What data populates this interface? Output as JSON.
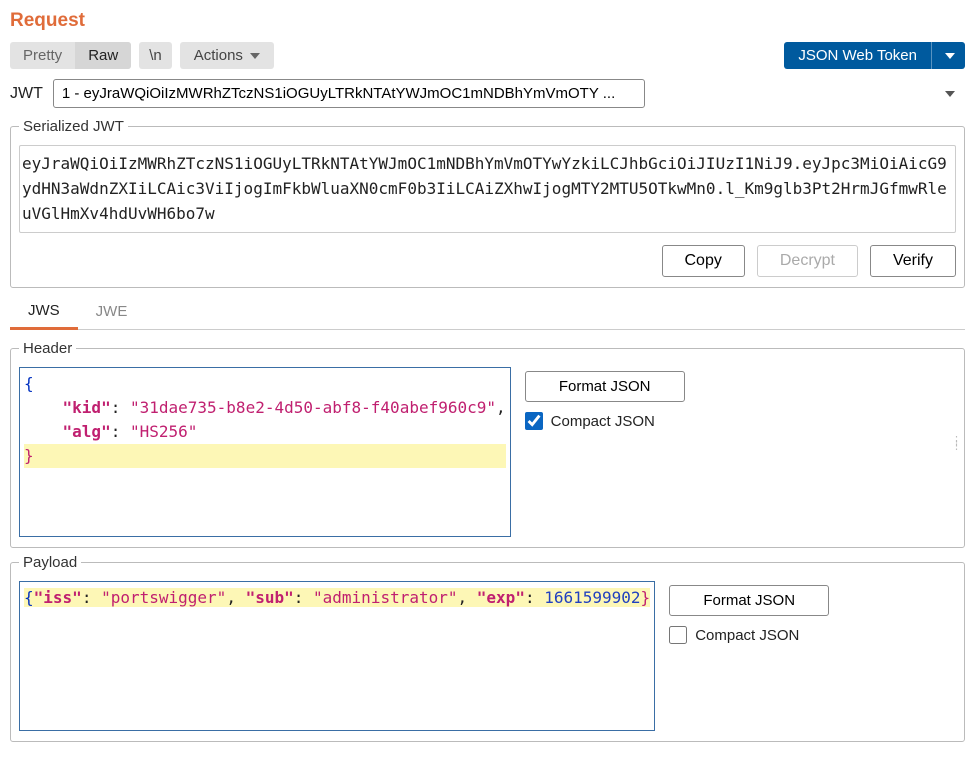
{
  "title": "Request",
  "toolbar": {
    "pretty_label": "Pretty",
    "raw_label": "Raw",
    "newline_label": "\\n",
    "actions_label": "Actions",
    "extension_label": "JSON Web Token"
  },
  "jwt_box": {
    "label": "JWT",
    "selected": "1 - eyJraWQiOiIzMWRhZTczNS1iOGUyLTRkNTAtYWJmOC1mNDBhYmVmOTY ..."
  },
  "serialized": {
    "legend": "Serialized JWT",
    "value": "eyJraWQiOiIzMWRhZTczNS1iOGUyLTRkNTAtYWJmOC1mNDBhYmVmOTYwYzkiLCJhbGciOiJIUzI1NiJ9.eyJpc3MiOiAicG9ydHN3aWdnZXIiLCAic3ViIjogImFkbWluaXN0cmF0b3IiLCAiZXhwIjogMTY2MTU5OTkwMn0.l_Km9glb3Pt2HrmJGfmwRleuVGlHmXv4hdUvWH6bo7w",
    "copy_label": "Copy",
    "decrypt_label": "Decrypt",
    "verify_label": "Verify"
  },
  "tabs": {
    "jws": "JWS",
    "jwe": "JWE"
  },
  "header_section": {
    "legend": "Header",
    "format_label": "Format JSON",
    "compact_label": "Compact JSON",
    "compact_checked": true,
    "json": {
      "kid": "31dae735-b8e2-4d50-abf8-f40abef960c9",
      "alg": "HS256"
    }
  },
  "payload_section": {
    "legend": "Payload",
    "format_label": "Format JSON",
    "compact_label": "Compact JSON",
    "compact_checked": false,
    "json": {
      "iss": "portswigger",
      "sub": "administrator",
      "exp": 1661599902
    }
  },
  "chart_data": null
}
